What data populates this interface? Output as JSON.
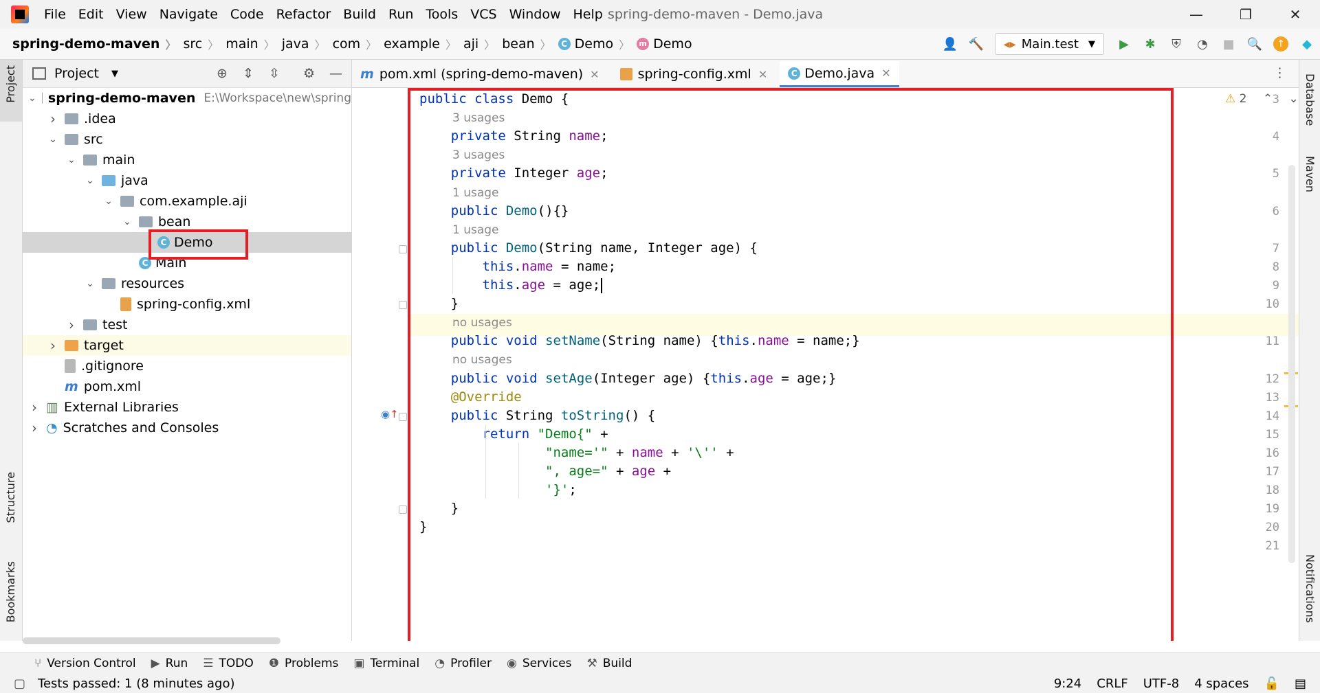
{
  "menubar": {
    "items": [
      "File",
      "Edit",
      "View",
      "Navigate",
      "Code",
      "Refactor",
      "Build",
      "Run",
      "Tools",
      "VCS",
      "Window",
      "Help"
    ],
    "window_title": "spring-demo-maven - Demo.java"
  },
  "navbar": {
    "breadcrumbs": [
      "spring-demo-maven",
      "src",
      "main",
      "java",
      "com",
      "example",
      "aji",
      "bean",
      "Demo",
      "Demo"
    ],
    "run_config": "Main.test"
  },
  "project_panel": {
    "title": "Project",
    "tree": [
      {
        "label": "spring-demo-maven",
        "extra": "E:\\Workspace\\new\\spring",
        "depth": 0,
        "arrow": "v",
        "icon": "folder"
      },
      {
        "label": ".idea",
        "depth": 1,
        "arrow": ">",
        "icon": "folder"
      },
      {
        "label": "src",
        "depth": 1,
        "arrow": "v",
        "icon": "folder"
      },
      {
        "label": "main",
        "depth": 2,
        "arrow": "v",
        "icon": "folder"
      },
      {
        "label": "java",
        "depth": 3,
        "arrow": "v",
        "icon": "folder-blue"
      },
      {
        "label": "com.example.aji",
        "depth": 4,
        "arrow": "v",
        "icon": "package"
      },
      {
        "label": "bean",
        "depth": 5,
        "arrow": "v",
        "icon": "package"
      },
      {
        "label": "Demo",
        "depth": 6,
        "arrow": "",
        "icon": "class",
        "selected": true
      },
      {
        "label": "Main",
        "depth": 5,
        "arrow": "",
        "icon": "class"
      },
      {
        "label": "resources",
        "depth": 3,
        "arrow": "v",
        "icon": "folder"
      },
      {
        "label": "spring-config.xml",
        "depth": 4,
        "arrow": "",
        "icon": "xml"
      },
      {
        "label": "test",
        "depth": 2,
        "arrow": ">",
        "icon": "folder"
      },
      {
        "label": "target",
        "depth": 1,
        "arrow": ">",
        "icon": "folder-orange",
        "highlight": true
      },
      {
        "label": ".gitignore",
        "depth": 1,
        "arrow": "",
        "icon": "file"
      },
      {
        "label": "pom.xml",
        "depth": 1,
        "arrow": "",
        "icon": "maven"
      },
      {
        "label": "External Libraries",
        "depth": 0,
        "arrow": ">",
        "icon": "libs"
      },
      {
        "label": "Scratches and Consoles",
        "depth": 0,
        "arrow": ">",
        "icon": "scratch"
      }
    ]
  },
  "tabs": [
    {
      "label": "pom.xml (spring-demo-maven)",
      "icon": "m"
    },
    {
      "label": "spring-config.xml",
      "icon": "xml"
    },
    {
      "label": "Demo.java",
      "icon": "c",
      "active": true
    }
  ],
  "editor": {
    "warnings": "2",
    "lines": [
      {
        "n": "3",
        "hint": "",
        "code": "public class Demo {"
      },
      {
        "n": "",
        "hint": "3 usages"
      },
      {
        "n": "4",
        "code": "    private String name;"
      },
      {
        "n": "",
        "hint": "3 usages"
      },
      {
        "n": "5",
        "code": "    private Integer age;"
      },
      {
        "n": "",
        "hint": "1 usage"
      },
      {
        "n": "6",
        "code": "    public Demo(){}"
      },
      {
        "n": "",
        "hint": "1 usage"
      },
      {
        "n": "7",
        "code": "    public Demo(String name, Integer age) {"
      },
      {
        "n": "8",
        "code": "        this.name = name;"
      },
      {
        "n": "9",
        "code": "        this.age = age;"
      },
      {
        "n": "10",
        "code": "    }"
      },
      {
        "n": "",
        "hint": "no usages"
      },
      {
        "n": "11",
        "code": "    public void setName(String name) {this.name = name;}"
      },
      {
        "n": "",
        "hint": "no usages"
      },
      {
        "n": "12",
        "code": "    public void setAge(Integer age) {this.age = age;}"
      },
      {
        "n": "13",
        "code": "    @Override"
      },
      {
        "n": "14",
        "code": "    public String toString() {"
      },
      {
        "n": "15",
        "code": "        return \"Demo{\" +"
      },
      {
        "n": "16",
        "code": "                \"name='\" + name + '\\'' +"
      },
      {
        "n": "17",
        "code": "                \", age=\" + age +"
      },
      {
        "n": "18",
        "code": "                '}';"
      },
      {
        "n": "19",
        "code": "    }"
      },
      {
        "n": "20",
        "code": "}"
      },
      {
        "n": "21",
        "code": ""
      }
    ]
  },
  "left_strip": {
    "project": "Project",
    "structure": "Structure",
    "bookmarks": "Bookmarks"
  },
  "right_strip": {
    "database": "Database",
    "maven": "Maven",
    "notifications": "Notifications"
  },
  "bottom_tools": [
    "Version Control",
    "Run",
    "TODO",
    "Problems",
    "Terminal",
    "Profiler",
    "Services",
    "Build"
  ],
  "status": {
    "message": "Tests passed: 1 (8 minutes ago)",
    "position": "9:24",
    "line_sep": "CRLF",
    "encoding": "UTF-8",
    "indent": "4 spaces"
  },
  "colors": {
    "accent": "#4083c9",
    "red_box": "#e31e24",
    "current_line": "#fefce3"
  }
}
